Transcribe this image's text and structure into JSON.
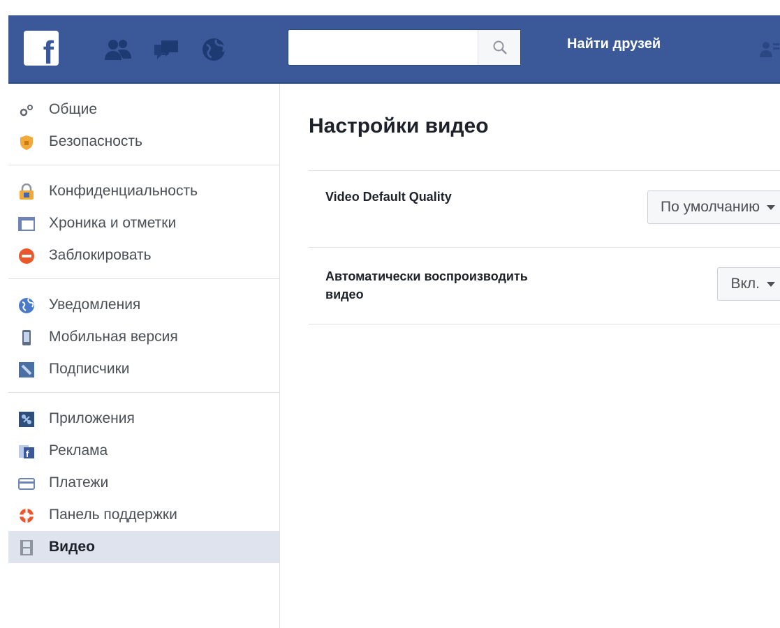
{
  "header": {
    "logo_letter": "f",
    "search": {
      "placeholder": "",
      "value": ""
    },
    "find_friends": "Найти друзей",
    "icons": [
      "friends-icon",
      "messages-icon",
      "notifications-globe-icon",
      "search-icon",
      "friend-requests-icon"
    ],
    "colors": {
      "bar": "#3b5998",
      "text": "#ffffff"
    }
  },
  "sidebar": {
    "groups": [
      {
        "items": [
          {
            "label": "Общие",
            "icon": "gears-icon"
          },
          {
            "label": "Безопасность",
            "icon": "shield-icon"
          }
        ]
      },
      {
        "items": [
          {
            "label": "Конфиденциальность",
            "icon": "lock-icon"
          },
          {
            "label": "Хроника и отметки",
            "icon": "timeline-icon"
          },
          {
            "label": "Заблокировать",
            "icon": "block-icon"
          }
        ]
      },
      {
        "items": [
          {
            "label": "Уведомления",
            "icon": "globe-icon"
          },
          {
            "label": "Мобильная версия",
            "icon": "mobile-icon"
          },
          {
            "label": "Подписчики",
            "icon": "rss-icon"
          }
        ]
      },
      {
        "items": [
          {
            "label": "Приложения",
            "icon": "apps-icon"
          },
          {
            "label": "Реклама",
            "icon": "ads-icon"
          },
          {
            "label": "Платежи",
            "icon": "payments-icon"
          },
          {
            "label": "Панель поддержки",
            "icon": "support-icon"
          },
          {
            "label": "Видео",
            "icon": "film-icon",
            "active": true
          }
        ]
      }
    ]
  },
  "main": {
    "title": "Настройки видео",
    "settings": [
      {
        "label": "Video Default Quality",
        "value": "По умолчанию"
      },
      {
        "label": "Автоматически воспроизводить видео",
        "value": "Вкл."
      }
    ]
  }
}
